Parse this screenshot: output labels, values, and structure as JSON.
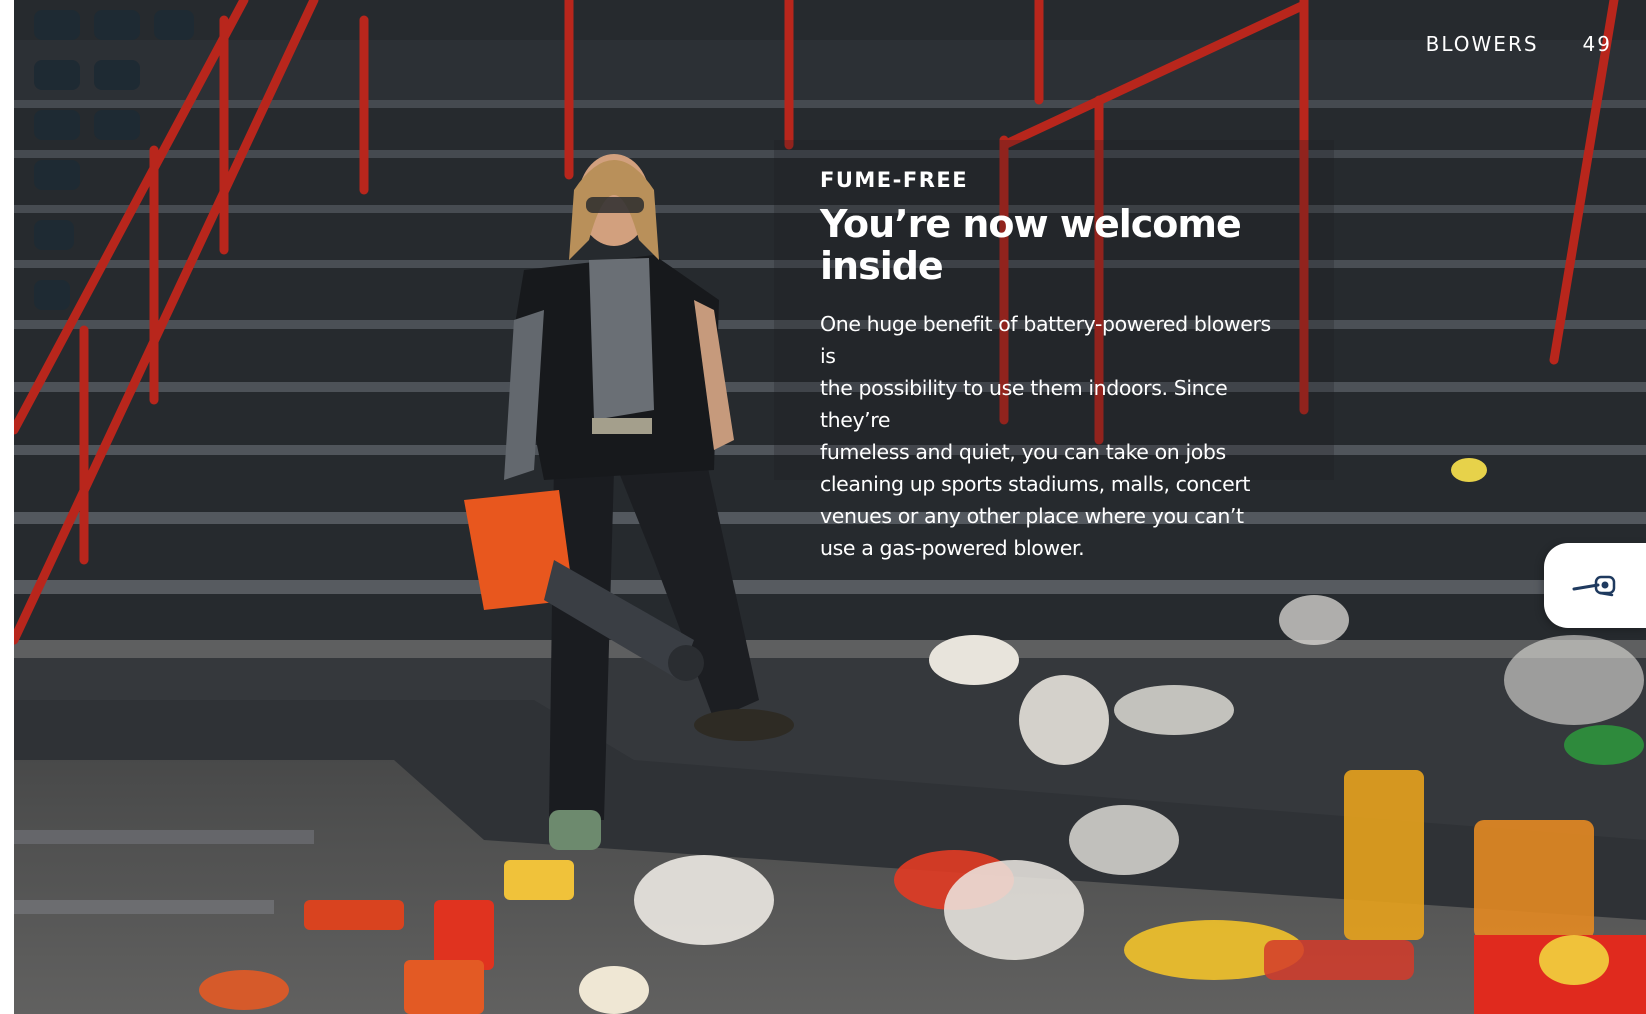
{
  "header": {
    "section": "BLOWERS",
    "page_number": "49"
  },
  "article": {
    "eyebrow": "FUME-FREE",
    "headline": "You’re now welcome inside",
    "body_lines": [
      "One huge benefit of battery-powered blowers is",
      "the possibility to use them indoors. Since they’re",
      "fumeless and quiet, you can take on jobs",
      "cleaning up sports stadiums, malls, concert",
      "venues or any other place where you can’t",
      "use a gas-powered blower."
    ]
  },
  "side_tab": {
    "icon": "leaf-blower-icon"
  },
  "colors": {
    "railing": "#b8261c",
    "blower": "#e8571e",
    "tab_icon": "#1f3a5f"
  }
}
